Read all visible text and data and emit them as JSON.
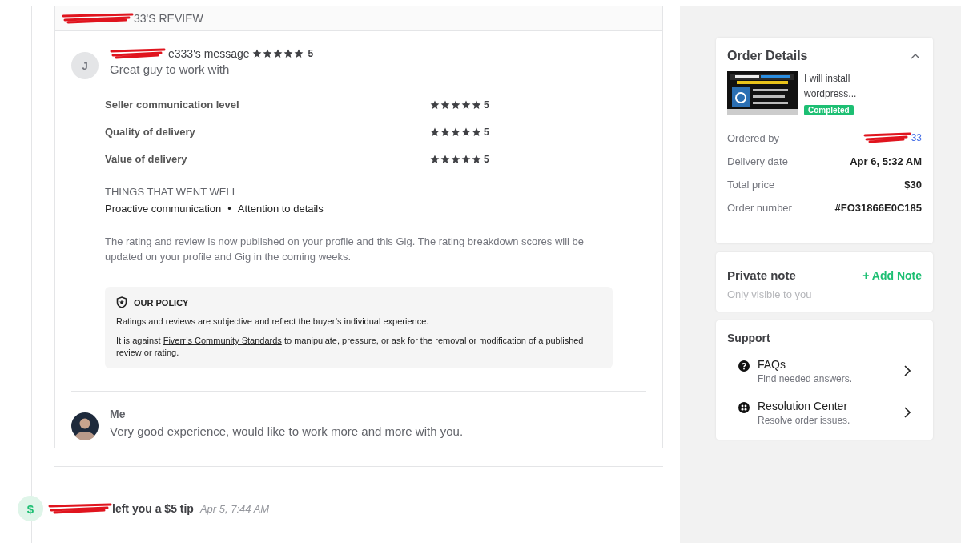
{
  "review": {
    "title": "33'S REVIEW",
    "buyer": {
      "avatar_letter": "J",
      "name": "e333's message",
      "stars": 5,
      "rating": "5",
      "comment": "Great guy to work with"
    },
    "ratings": [
      {
        "label": "Seller communication level",
        "stars": 5,
        "rating": "5"
      },
      {
        "label": "Quality of delivery",
        "stars": 5,
        "rating": "5"
      },
      {
        "label": "Value of delivery",
        "stars": 5,
        "rating": "5"
      }
    ],
    "went_well": {
      "heading": "THINGS THAT WENT WELL",
      "items": [
        "Proactive communication",
        "Attention to details"
      ],
      "separator": "•"
    },
    "notice": "The rating and review is now published on your profile and this Gig. The rating breakdown scores will be updated on your profile and Gig in the coming weeks.",
    "policy": {
      "title": "OUR POLICY",
      "line": "Ratings and reviews are subjective and reflect the buyer’s individual experience.",
      "before_link": "It is against",
      "link": "Fiverr’s Community Standards",
      "after_link": "to manipulate, pressure, or ask for the removal or modification of a published review or rating."
    },
    "reply": {
      "name": "Me",
      "text": "Very good experience, would like to work more and more with you."
    }
  },
  "tip": {
    "icon": "$",
    "text": "left you a $5 tip",
    "time": "Apr 5, 7:44 AM"
  },
  "order": {
    "title": "Order Details",
    "expanded": true,
    "gig_title": "I will install wordpress...",
    "status": "Completed",
    "fields": [
      {
        "label": "Ordered by",
        "value": "33",
        "kind": "link"
      },
      {
        "label": "Delivery date",
        "value": "Apr 6, 5:32 AM",
        "kind": "text"
      },
      {
        "label": "Total price",
        "value": "$30",
        "kind": "text"
      },
      {
        "label": "Order number",
        "value": "#FO31866E0C185",
        "kind": "text"
      }
    ]
  },
  "private_note": {
    "title": "Private note",
    "action": "+ Add Note",
    "hint": "Only visible to you"
  },
  "support": {
    "title": "Support",
    "items": [
      {
        "kind": "question",
        "title": "FAQs",
        "subtitle": "Find needed answers."
      },
      {
        "kind": "resolution",
        "title": "Resolution Center",
        "subtitle": "Resolve order issues."
      }
    ]
  }
}
